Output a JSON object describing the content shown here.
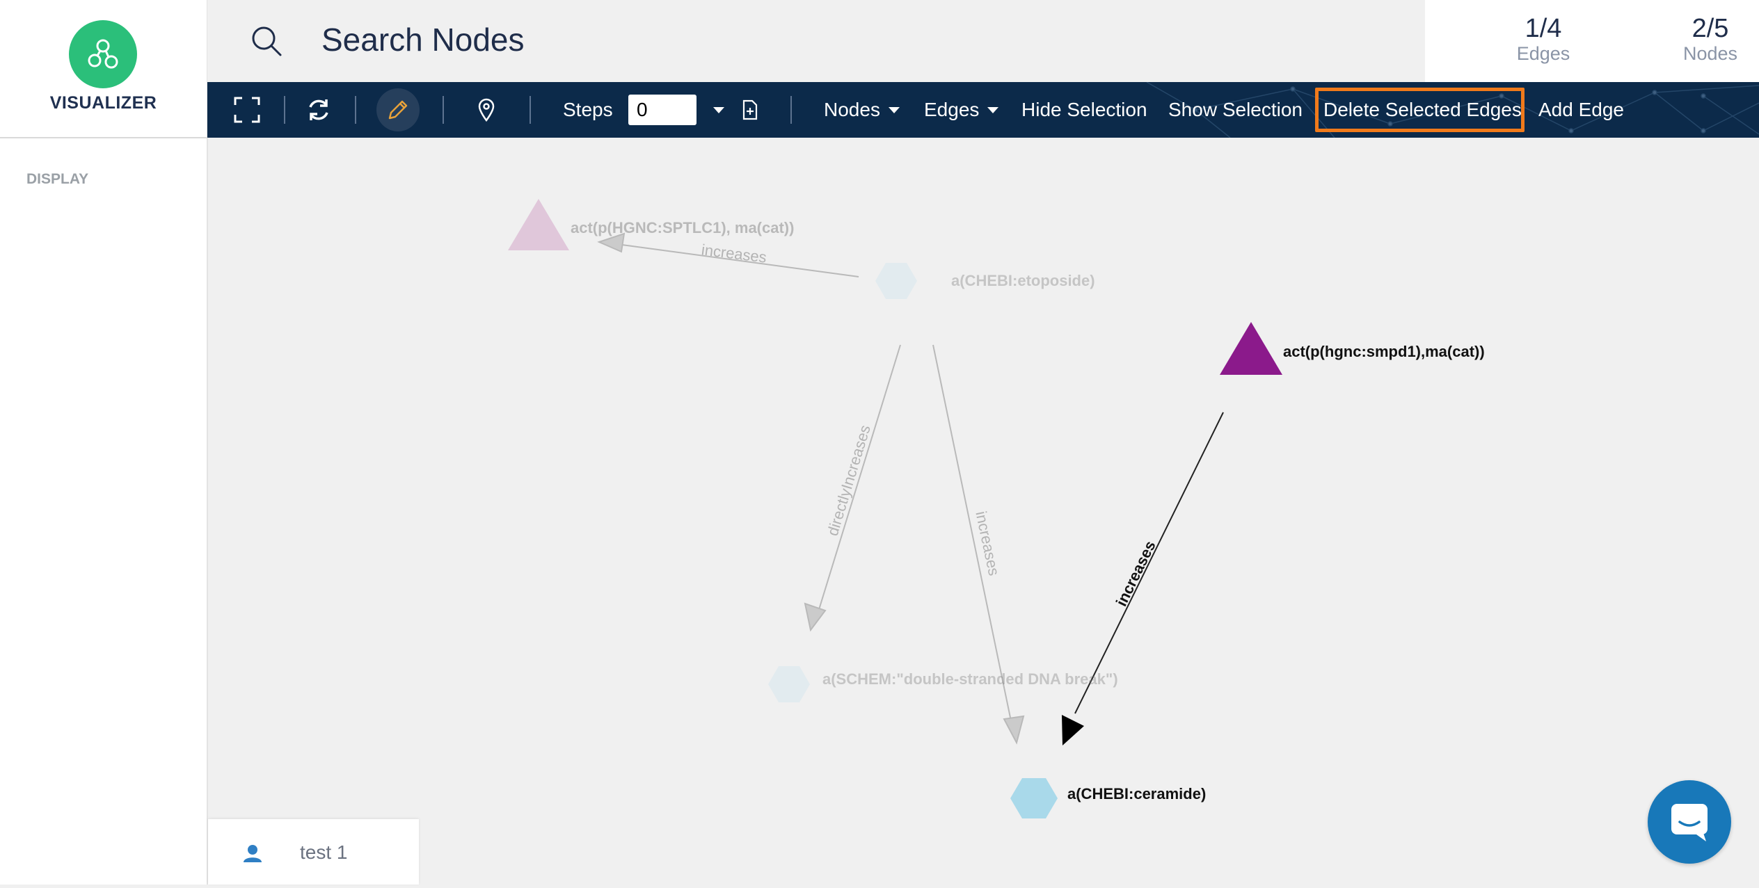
{
  "app": {
    "title": "VISUALIZER",
    "sidebar_section": "DISPLAY"
  },
  "search": {
    "placeholder": "Search Nodes"
  },
  "stats": {
    "edges_value": "1/4",
    "edges_label": "Edges",
    "nodes_value": "2/5",
    "nodes_label": "Nodes"
  },
  "toolbar": {
    "steps_label": "Steps",
    "steps_value": "0",
    "nodes_menu": "Nodes",
    "edges_menu": "Edges",
    "hide_selection": "Hide Selection",
    "show_selection": "Show Selection",
    "delete_selected_edges": "Delete Selected Edges",
    "add_edge": "Add Edge"
  },
  "graph": {
    "nodes": {
      "sptlc1": "act(p(HGNC:SPTLC1), ma(cat))",
      "etoposide": "a(CHEBI:etoposide)",
      "smpd1": "act(p(hgnc:smpd1),ma(cat))",
      "dna_break": "a(SCHEM:\"double-stranded DNA break\")",
      "ceramide": "a(CHEBI:ceramide)"
    },
    "edges": {
      "etoposide_sptlc1": "increases",
      "etoposide_dna_break": "directlyIncreases",
      "etoposide_ceramide": "increases",
      "smpd1_ceramide": "increases"
    }
  },
  "user": {
    "name": "test 1"
  },
  "colors": {
    "brand_green": "#2bbf7a",
    "toolbar_bg": "#0c2a4a",
    "highlight": "#f07a1b",
    "triangle_selected": "#8b1a8b",
    "hexagon": "#a9d9ea",
    "chat_button": "#1878b9"
  },
  "icons": {
    "logo": "graph-nodes-icon",
    "search": "search-icon",
    "fullscreen": "fullscreen-icon",
    "refresh": "refresh-icon",
    "edit": "pencil-icon",
    "location": "location-pin-icon",
    "add_file": "add-file-icon",
    "user": "user-icon",
    "chat": "chat-icon"
  }
}
